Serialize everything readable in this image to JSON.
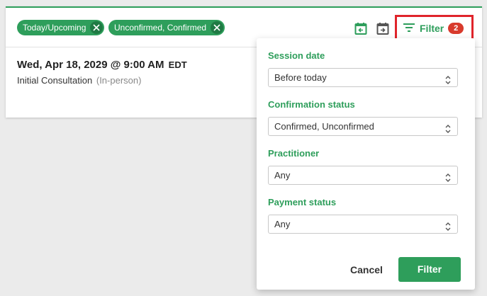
{
  "filters": {
    "chips": [
      {
        "label": "Today/Upcoming"
      },
      {
        "label": "Unconfirmed, Confirmed"
      }
    ],
    "toggle_label": "Filter",
    "active_count": "2"
  },
  "session": {
    "datetime": "Wed, Apr 18, 2029 @ 9:00 AM",
    "timezone": "EDT",
    "type": "Initial Consultation",
    "mode": "(In-person)"
  },
  "panel": {
    "fields": [
      {
        "label": "Session date",
        "value": "Before today"
      },
      {
        "label": "Confirmation status",
        "value": "Confirmed, Unconfirmed"
      },
      {
        "label": "Practitioner",
        "value": "Any"
      },
      {
        "label": "Payment status",
        "value": "Any"
      }
    ],
    "cancel_label": "Cancel",
    "submit_label": "Filter"
  },
  "colors": {
    "accent": "#2e9e5b",
    "badge": "#d83a2c",
    "highlight": "#e0242b"
  },
  "icons": {
    "chip_remove": "close-icon",
    "prev_date": "calendar-arrow-left-icon",
    "next_date": "calendar-arrow-right-icon",
    "filter": "filter-lines-icon",
    "select": "chevron-up-down-icon"
  }
}
